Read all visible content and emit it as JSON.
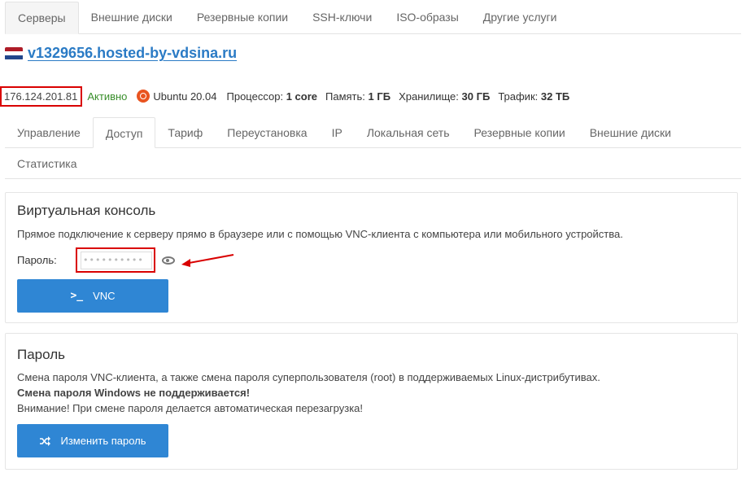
{
  "top_tabs": [
    "Серверы",
    "Внешние диски",
    "Резервные копии",
    "SSH-ключи",
    "ISO-образы",
    "Другие услуги"
  ],
  "server": {
    "hostname": "v1329656.hosted-by-vdsina.ru",
    "flag_colors": [
      "#ae1c28",
      "#ffffff",
      "#21468b"
    ],
    "ip": "176.124.201.81",
    "status": "Активно",
    "os_icon": "ubuntu-icon",
    "os": "Ubuntu 20.04",
    "cpu_label": "Процессор:",
    "cpu_value": "1 core",
    "ram_label": "Память:",
    "ram_value": "1 ГБ",
    "storage_label": "Хранилище:",
    "storage_value": "30 ГБ",
    "traffic_label": "Трафик:",
    "traffic_value": "32 ТБ"
  },
  "sub_tabs_row1": [
    "Управление",
    "Доступ",
    "Тариф",
    "Переустановка",
    "IP",
    "Локальная сеть",
    "Резервные копии",
    "Внешние диски"
  ],
  "sub_tabs_row2": [
    "Статистика"
  ],
  "console": {
    "title": "Виртуальная консоль",
    "description": "Прямое подключение к серверу прямо в браузере или с помощью VNC-клиента с компьютера или мобильного устройства.",
    "password_label": "Пароль:",
    "password_mask": "••••••••••",
    "button_icon": ">_",
    "button_label": "VNC"
  },
  "password_panel": {
    "title": "Пароль",
    "line1": "Смена пароля VNC-клиента, а также смена пароля суперпользователя (root) в поддерживаемых Linux-дистрибутивах.",
    "line2": "Смена пароля Windows не поддерживается!",
    "line3": "Внимание! При смене пароля делается автоматическая перезагрузка!",
    "button_icon": "shuffle-icon",
    "button_label": "Изменить пароль"
  },
  "colors": {
    "accent": "#2f86d4",
    "highlight": "#d90000",
    "status_green": "#3a8f2c",
    "link": "#2b7bc5"
  }
}
